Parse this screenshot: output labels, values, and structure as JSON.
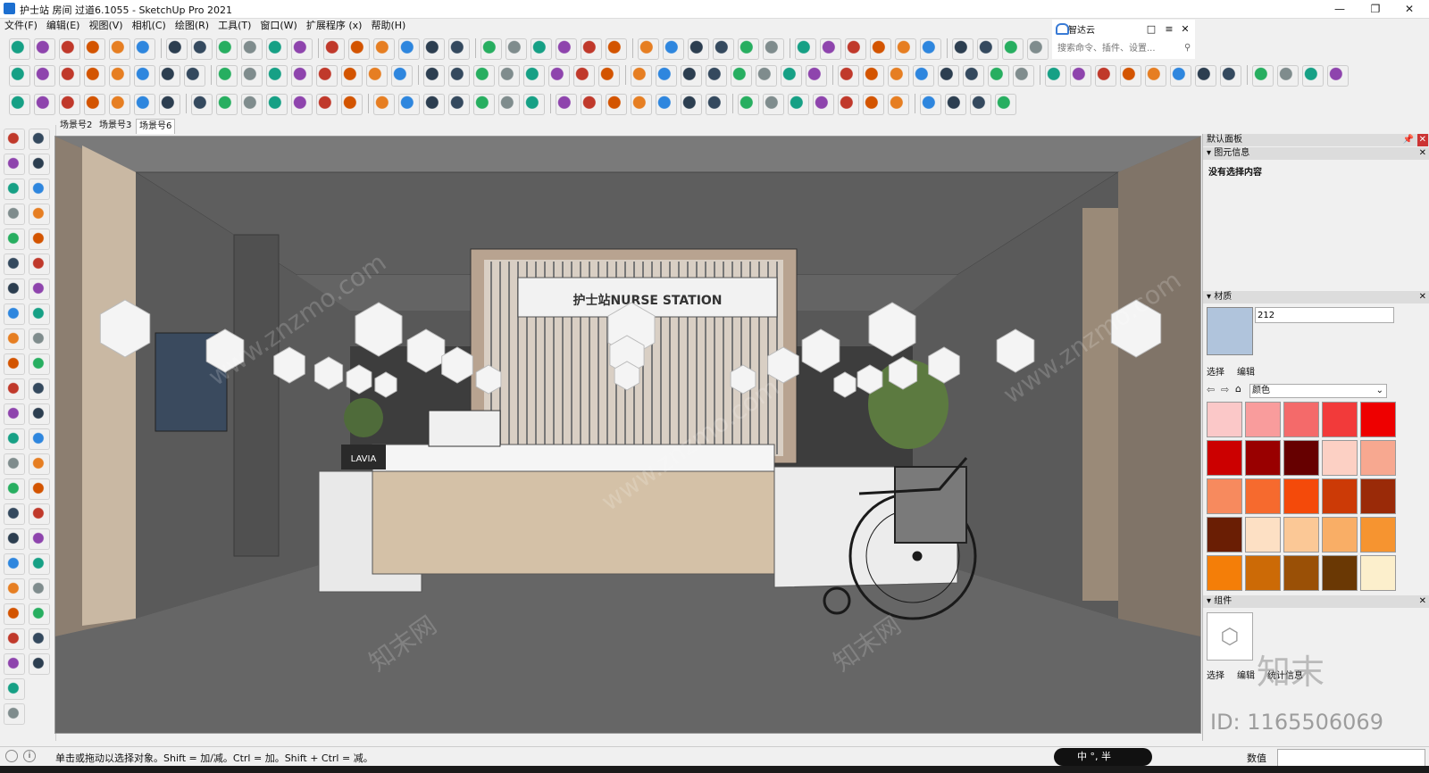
{
  "window": {
    "title": "护士站 房间 过道6.1055 - SketchUp Pro 2021",
    "controls": [
      "—",
      "❐",
      "✕"
    ]
  },
  "menu": [
    "文件(F)",
    "编辑(E)",
    "视图(V)",
    "相机(C)",
    "绘图(R)",
    "工具(T)",
    "窗口(W)",
    "扩展程序 (x)",
    "帮助(H)"
  ],
  "zhidayun": {
    "title": "智达云",
    "search_placeholder": "搜索命令、插件、设置..."
  },
  "scene_tabs": [
    "场景号2",
    "场景号3",
    "场景号6"
  ],
  "viewport": {
    "sign_text": "护士站NURSE STATION",
    "desk_label": "LAVIA",
    "watermarks": [
      "www.znzmo.com",
      "知末网"
    ]
  },
  "right_panel": {
    "tray_title": "默认面板",
    "entity_info": {
      "title": "图元信息",
      "status": "没有选择内容"
    },
    "materials": {
      "title": "材质",
      "material_name": "212",
      "tabs": [
        "选择",
        "编辑"
      ],
      "library": "颜色",
      "swatches": [
        "#fbc8c8",
        "#f99c9c",
        "#f46a6a",
        "#f23a3a",
        "#ee0000",
        "#cc0000",
        "#990000",
        "#660000",
        "#fcd0c4",
        "#f7a890",
        "#f78a5e",
        "#f66a2e",
        "#f44a0a",
        "#cc3a06",
        "#9a2a08",
        "#6a1e04",
        "#fde0c4",
        "#fbc896",
        "#f9ae66",
        "#f69430",
        "#f47e08",
        "#cc6a06",
        "#9a5006",
        "#6a3804",
        "#fcefcc"
      ]
    },
    "components": {
      "title": "组件",
      "tabs": [
        "选择",
        "编辑",
        "统计信息"
      ]
    }
  },
  "watermark": {
    "logo": "知末",
    "id": "ID: 1165506069"
  },
  "status": {
    "hint": "单击或拖动以选择对象。Shift = 加/减。Ctrl = 加。Shift + Ctrl = 减。",
    "ime": "中 °, 半",
    "measure_label": "数值"
  },
  "colors": {
    "accent": "#1c6fd0",
    "viewport_bg": "#6d6d6d"
  }
}
